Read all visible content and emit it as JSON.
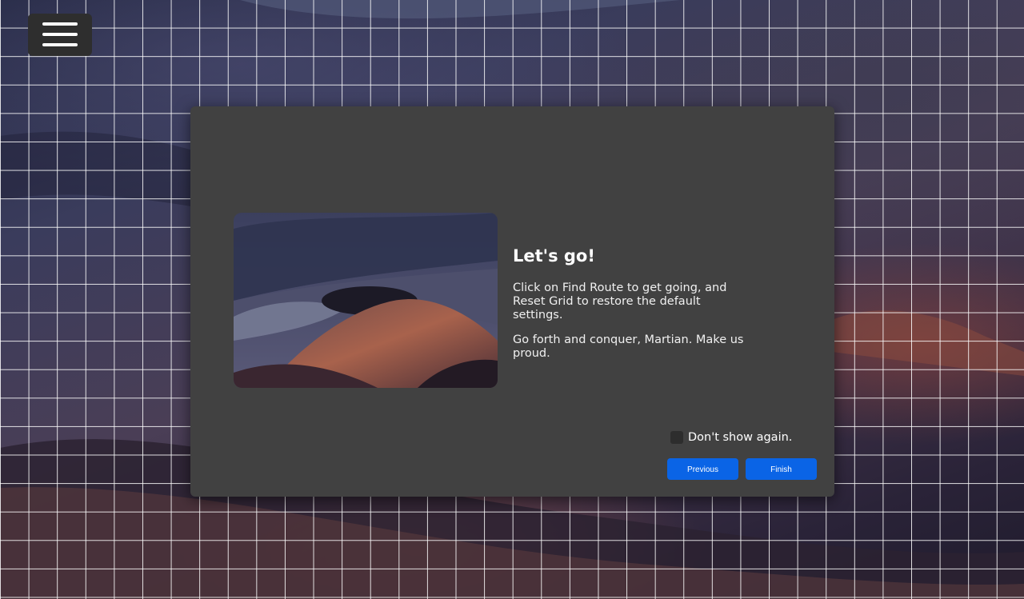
{
  "app": {
    "menu_icon": "hamburger-menu-icon"
  },
  "dialog": {
    "title": "Let's go!",
    "paragraph_1": "Click on Find Route to get going, and Reset Grid to restore the default settings.",
    "paragraph_2": "Go forth and conquer, Martian. Make us proud.",
    "checkbox_label": "Don't show again.",
    "checkbox_checked": false,
    "previous_label": "Previous",
    "finish_label": "Finish"
  },
  "colors": {
    "dialog_bg": "#414141",
    "button_bg": "#0a64e6",
    "grid_line": "#ffffff"
  }
}
